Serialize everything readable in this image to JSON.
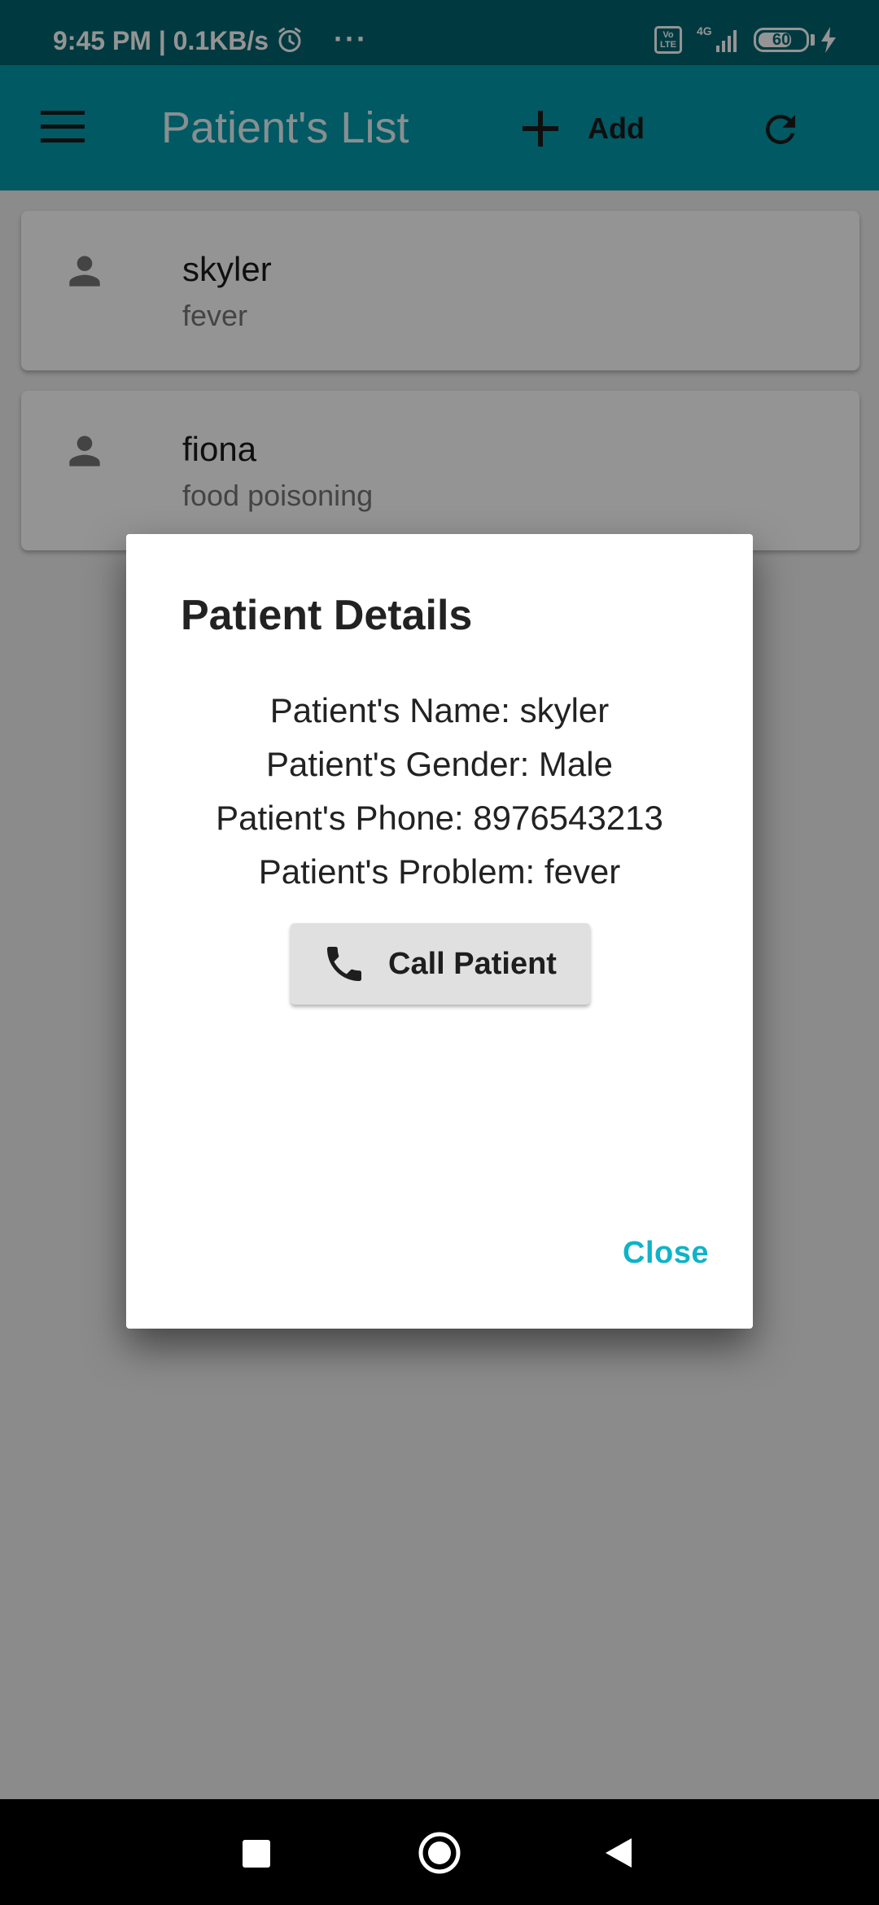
{
  "status_bar": {
    "time": "9:45 PM | 0.1KB/s",
    "dots": "···",
    "volte": "Vo LTE",
    "network": "4G",
    "battery": "60"
  },
  "app_bar": {
    "title": "Patient's List",
    "add_label": "Add"
  },
  "patients": [
    {
      "name": "skyler",
      "problem": "fever"
    },
    {
      "name": "fiona",
      "problem": "food poisoning"
    }
  ],
  "dialog": {
    "title": "Patient Details",
    "lines": [
      "Patient's Name: skyler",
      "Patient's Gender: Male",
      "Patient's Phone: 8976543213",
      "Patient's Problem: fever"
    ],
    "call_label": "Call Patient",
    "close_label": "Close"
  },
  "colors": {
    "status_bar": "#00646f",
    "app_bar": "#009aab",
    "accent": "#0fb3c9",
    "list_background": "#f0f0f0",
    "scrim": "rgba(0,0,0,0.42)"
  },
  "icons": [
    "alarm-icon",
    "menu-icon",
    "add-icon",
    "refresh-icon",
    "person-icon",
    "phone-icon",
    "signal-icon",
    "battery-icon",
    "bolt-icon"
  ]
}
